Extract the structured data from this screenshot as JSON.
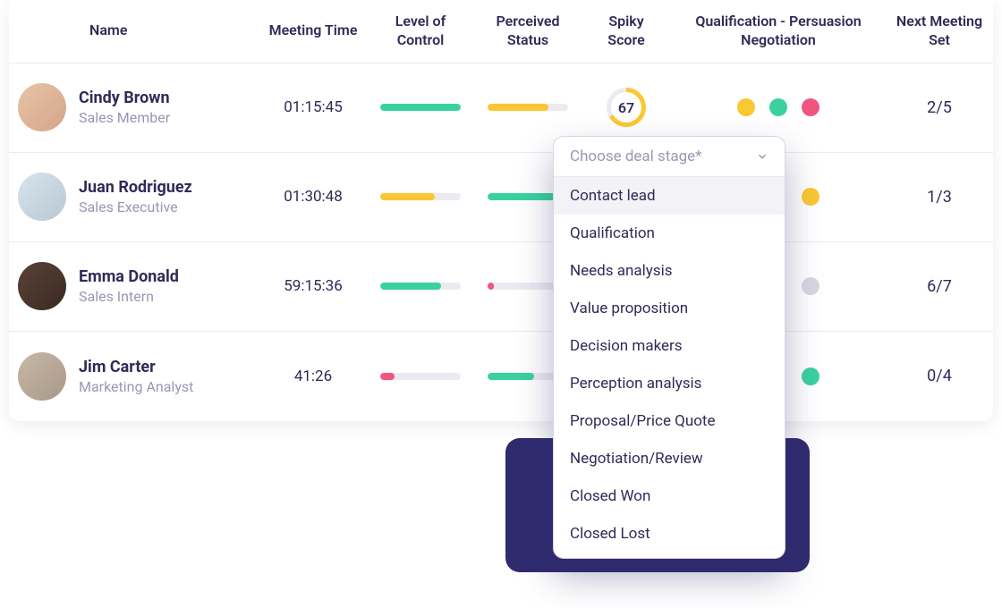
{
  "colors": {
    "green": "#3ad19f",
    "yellow": "#fbc733",
    "pink": "#f1547f",
    "grey": "#d8d6e4"
  },
  "headers": {
    "name": "Name",
    "meeting_time": "Meeting Time",
    "level_control": "Level of Control",
    "perceived_status": "Perceived Status",
    "spiky_score": "Spiky Score",
    "qpn": "Qualification - Persuasion Negotiation",
    "next_meeting": "Next Meeting Set"
  },
  "rows": [
    {
      "name": "Cindy Brown",
      "role": "Sales Member",
      "avatar_bg": "linear-gradient(135deg,#e8c4a8,#d4a58a)",
      "time": "01:15:45",
      "control": {
        "pct": 100,
        "color": "#3ad19f"
      },
      "status": {
        "pct": 75,
        "color": "#fbc733"
      },
      "score": "67",
      "dots": [
        "#fbc733",
        "#3ad19f",
        "#f1547f"
      ],
      "next": "2/5"
    },
    {
      "name": "Juan Rodriguez",
      "role": "Sales Executive",
      "avatar_bg": "linear-gradient(135deg,#d8e4ec,#b8c8d4)",
      "time": "01:30:48",
      "control": {
        "pct": 68,
        "color": "#fbc733"
      },
      "status": {
        "pct": 88,
        "color": "#3ad19f"
      },
      "score": "",
      "dots": [
        "",
        "",
        "#fbc733"
      ],
      "next": "1/3"
    },
    {
      "name": "Emma Donald",
      "role": "Sales Intern",
      "avatar_bg": "linear-gradient(135deg,#5a4238,#3a2a22)",
      "time": "59:15:36",
      "control": {
        "pct": 75,
        "color": "#3ad19f"
      },
      "status": {
        "pct": 8,
        "color": "#f1547f"
      },
      "score": "",
      "dots": [
        "",
        "",
        "#d8d6e4"
      ],
      "next": "6/7"
    },
    {
      "name": "Jim Carter",
      "role": "Marketing Analyst",
      "avatar_bg": "linear-gradient(135deg,#c8b8a8,#a89888)",
      "time": "41:26",
      "control": {
        "pct": 18,
        "color": "#f1547f"
      },
      "status": {
        "pct": 58,
        "color": "#3ad19f"
      },
      "score": "",
      "dots": [
        "",
        "",
        "#3ad19f"
      ],
      "next": "0/4"
    }
  ],
  "dropdown": {
    "placeholder": "Choose deal stage*",
    "options": [
      "Contact lead",
      "Qualification",
      "Needs analysis",
      "Value proposition",
      "Decision makers",
      "Perception analysis",
      "Proposal/Price Quote",
      "Negotiation/Review",
      "Closed Won",
      "Closed Lost"
    ],
    "highlighted_index": 0
  }
}
